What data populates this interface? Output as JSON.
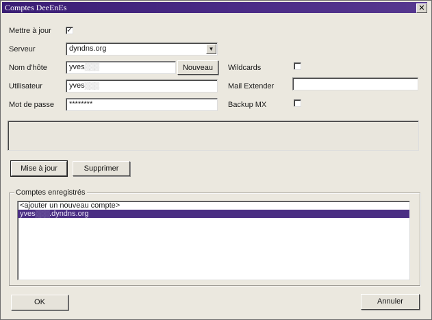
{
  "window": {
    "title": "Comptes DeeEnEs",
    "close_glyph": "✕"
  },
  "form": {
    "update_label": "Mettre à jour",
    "update_checked": true,
    "server_label": "Serveur",
    "server_value": "dyndns.org",
    "hostname_label": "Nom d'hôte",
    "hostname_value": "yves",
    "hostname_blurred": "▒▒▒",
    "new_button": "Nouveau",
    "user_label": "Utilisateur",
    "user_value": "yves",
    "user_blurred": "▒▒▒",
    "password_label": "Mot de passe",
    "password_value": "********",
    "wildcards_label": "Wildcards",
    "wildcards_checked": false,
    "mail_extender_label": "Mail Extender",
    "mail_extender_value": "",
    "backup_mx_label": "Backup MX",
    "backup_mx_checked": false
  },
  "actions": {
    "update_button": "Mise à jour",
    "delete_button": "Supprimer"
  },
  "accounts": {
    "group_label": "Comptes enregistrés",
    "items": [
      {
        "label": "<ajouter un nouveau compte>",
        "selected": false
      },
      {
        "label_prefix": "yves",
        "label_blur": "▒▒▒",
        "label_suffix": ".dyndns.org",
        "selected": true
      }
    ]
  },
  "footer": {
    "ok_button": "OK",
    "cancel_button": "Annuler"
  },
  "icons": {
    "dropdown": "chevron-down-icon",
    "close": "close-icon"
  },
  "colors": {
    "title_bar": "#3a1e74",
    "selection": "#4a2e83"
  }
}
